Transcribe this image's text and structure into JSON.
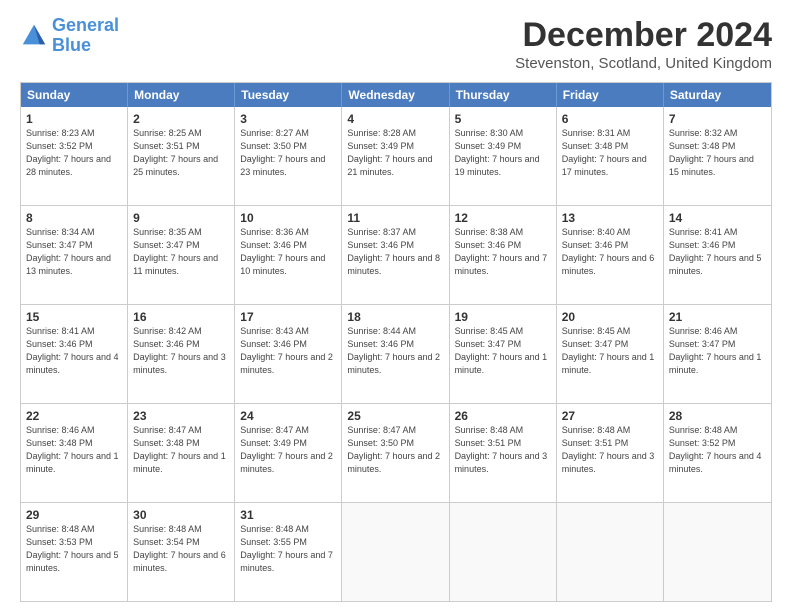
{
  "logo": {
    "line1": "General",
    "line2": "Blue"
  },
  "header": {
    "month": "December 2024",
    "location": "Stevenston, Scotland, United Kingdom"
  },
  "weekdays": [
    "Sunday",
    "Monday",
    "Tuesday",
    "Wednesday",
    "Thursday",
    "Friday",
    "Saturday"
  ],
  "weeks": [
    [
      {
        "day": 1,
        "rise": "8:23 AM",
        "set": "3:52 PM",
        "daylight": "7 hours and 28 minutes."
      },
      {
        "day": 2,
        "rise": "8:25 AM",
        "set": "3:51 PM",
        "daylight": "7 hours and 25 minutes."
      },
      {
        "day": 3,
        "rise": "8:27 AM",
        "set": "3:50 PM",
        "daylight": "7 hours and 23 minutes."
      },
      {
        "day": 4,
        "rise": "8:28 AM",
        "set": "3:49 PM",
        "daylight": "7 hours and 21 minutes."
      },
      {
        "day": 5,
        "rise": "8:30 AM",
        "set": "3:49 PM",
        "daylight": "7 hours and 19 minutes."
      },
      {
        "day": 6,
        "rise": "8:31 AM",
        "set": "3:48 PM",
        "daylight": "7 hours and 17 minutes."
      },
      {
        "day": 7,
        "rise": "8:32 AM",
        "set": "3:48 PM",
        "daylight": "7 hours and 15 minutes."
      }
    ],
    [
      {
        "day": 8,
        "rise": "8:34 AM",
        "set": "3:47 PM",
        "daylight": "7 hours and 13 minutes."
      },
      {
        "day": 9,
        "rise": "8:35 AM",
        "set": "3:47 PM",
        "daylight": "7 hours and 11 minutes."
      },
      {
        "day": 10,
        "rise": "8:36 AM",
        "set": "3:46 PM",
        "daylight": "7 hours and 10 minutes."
      },
      {
        "day": 11,
        "rise": "8:37 AM",
        "set": "3:46 PM",
        "daylight": "7 hours and 8 minutes."
      },
      {
        "day": 12,
        "rise": "8:38 AM",
        "set": "3:46 PM",
        "daylight": "7 hours and 7 minutes."
      },
      {
        "day": 13,
        "rise": "8:40 AM",
        "set": "3:46 PM",
        "daylight": "7 hours and 6 minutes."
      },
      {
        "day": 14,
        "rise": "8:41 AM",
        "set": "3:46 PM",
        "daylight": "7 hours and 5 minutes."
      }
    ],
    [
      {
        "day": 15,
        "rise": "8:41 AM",
        "set": "3:46 PM",
        "daylight": "7 hours and 4 minutes."
      },
      {
        "day": 16,
        "rise": "8:42 AM",
        "set": "3:46 PM",
        "daylight": "7 hours and 3 minutes."
      },
      {
        "day": 17,
        "rise": "8:43 AM",
        "set": "3:46 PM",
        "daylight": "7 hours and 2 minutes."
      },
      {
        "day": 18,
        "rise": "8:44 AM",
        "set": "3:46 PM",
        "daylight": "7 hours and 2 minutes."
      },
      {
        "day": 19,
        "rise": "8:45 AM",
        "set": "3:47 PM",
        "daylight": "7 hours and 1 minute."
      },
      {
        "day": 20,
        "rise": "8:45 AM",
        "set": "3:47 PM",
        "daylight": "7 hours and 1 minute."
      },
      {
        "day": 21,
        "rise": "8:46 AM",
        "set": "3:47 PM",
        "daylight": "7 hours and 1 minute."
      }
    ],
    [
      {
        "day": 22,
        "rise": "8:46 AM",
        "set": "3:48 PM",
        "daylight": "7 hours and 1 minute."
      },
      {
        "day": 23,
        "rise": "8:47 AM",
        "set": "3:48 PM",
        "daylight": "7 hours and 1 minute."
      },
      {
        "day": 24,
        "rise": "8:47 AM",
        "set": "3:49 PM",
        "daylight": "7 hours and 2 minutes."
      },
      {
        "day": 25,
        "rise": "8:47 AM",
        "set": "3:50 PM",
        "daylight": "7 hours and 2 minutes."
      },
      {
        "day": 26,
        "rise": "8:48 AM",
        "set": "3:51 PM",
        "daylight": "7 hours and 3 minutes."
      },
      {
        "day": 27,
        "rise": "8:48 AM",
        "set": "3:51 PM",
        "daylight": "7 hours and 3 minutes."
      },
      {
        "day": 28,
        "rise": "8:48 AM",
        "set": "3:52 PM",
        "daylight": "7 hours and 4 minutes."
      }
    ],
    [
      {
        "day": 29,
        "rise": "8:48 AM",
        "set": "3:53 PM",
        "daylight": "7 hours and 5 minutes."
      },
      {
        "day": 30,
        "rise": "8:48 AM",
        "set": "3:54 PM",
        "daylight": "7 hours and 6 minutes."
      },
      {
        "day": 31,
        "rise": "8:48 AM",
        "set": "3:55 PM",
        "daylight": "7 hours and 7 minutes."
      },
      null,
      null,
      null,
      null
    ]
  ]
}
